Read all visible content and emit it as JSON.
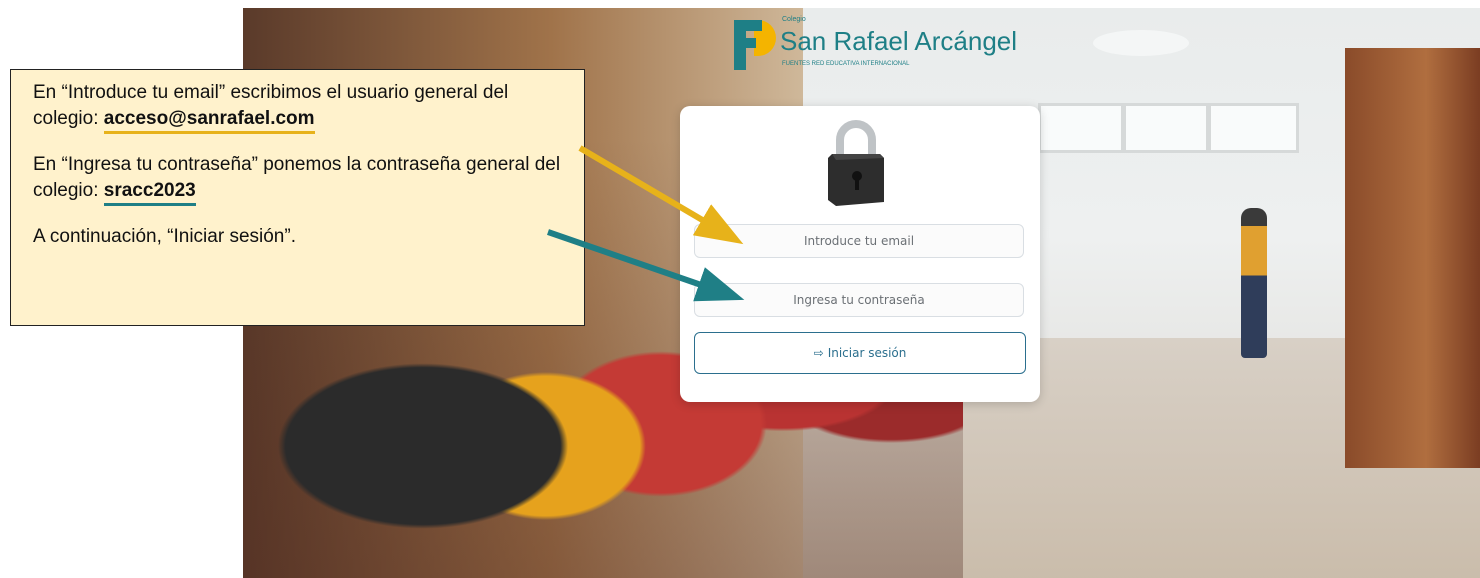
{
  "logo": {
    "colegio": "Colegio",
    "name": "San Rafael Arcángel",
    "tagline": "FUENTES RED EDUCATIVA INTERNACIONAL"
  },
  "login": {
    "email_placeholder": "Introduce tu email",
    "password_placeholder": "Ingresa tu contraseña",
    "button_icon": "login-arrow-icon",
    "button_label": "Iniciar sesión",
    "lock_icon": "padlock-icon"
  },
  "callout": {
    "line1_prefix": "En “Introduce tu email” escribimos el usuario general del colegio: ",
    "email_value": "acceso@sanrafael.com",
    "line2_prefix": "En “Ingresa tu contraseña” ponemos la contraseña general del colegio: ",
    "password_value": "sracc2023",
    "line3": "A continuación, “Iniciar sesión”."
  },
  "colors": {
    "email_arrow": "#e7b21a",
    "password_arrow": "#1f7f86",
    "callout_bg": "#fff2cc",
    "brand": "#1e7f86"
  }
}
